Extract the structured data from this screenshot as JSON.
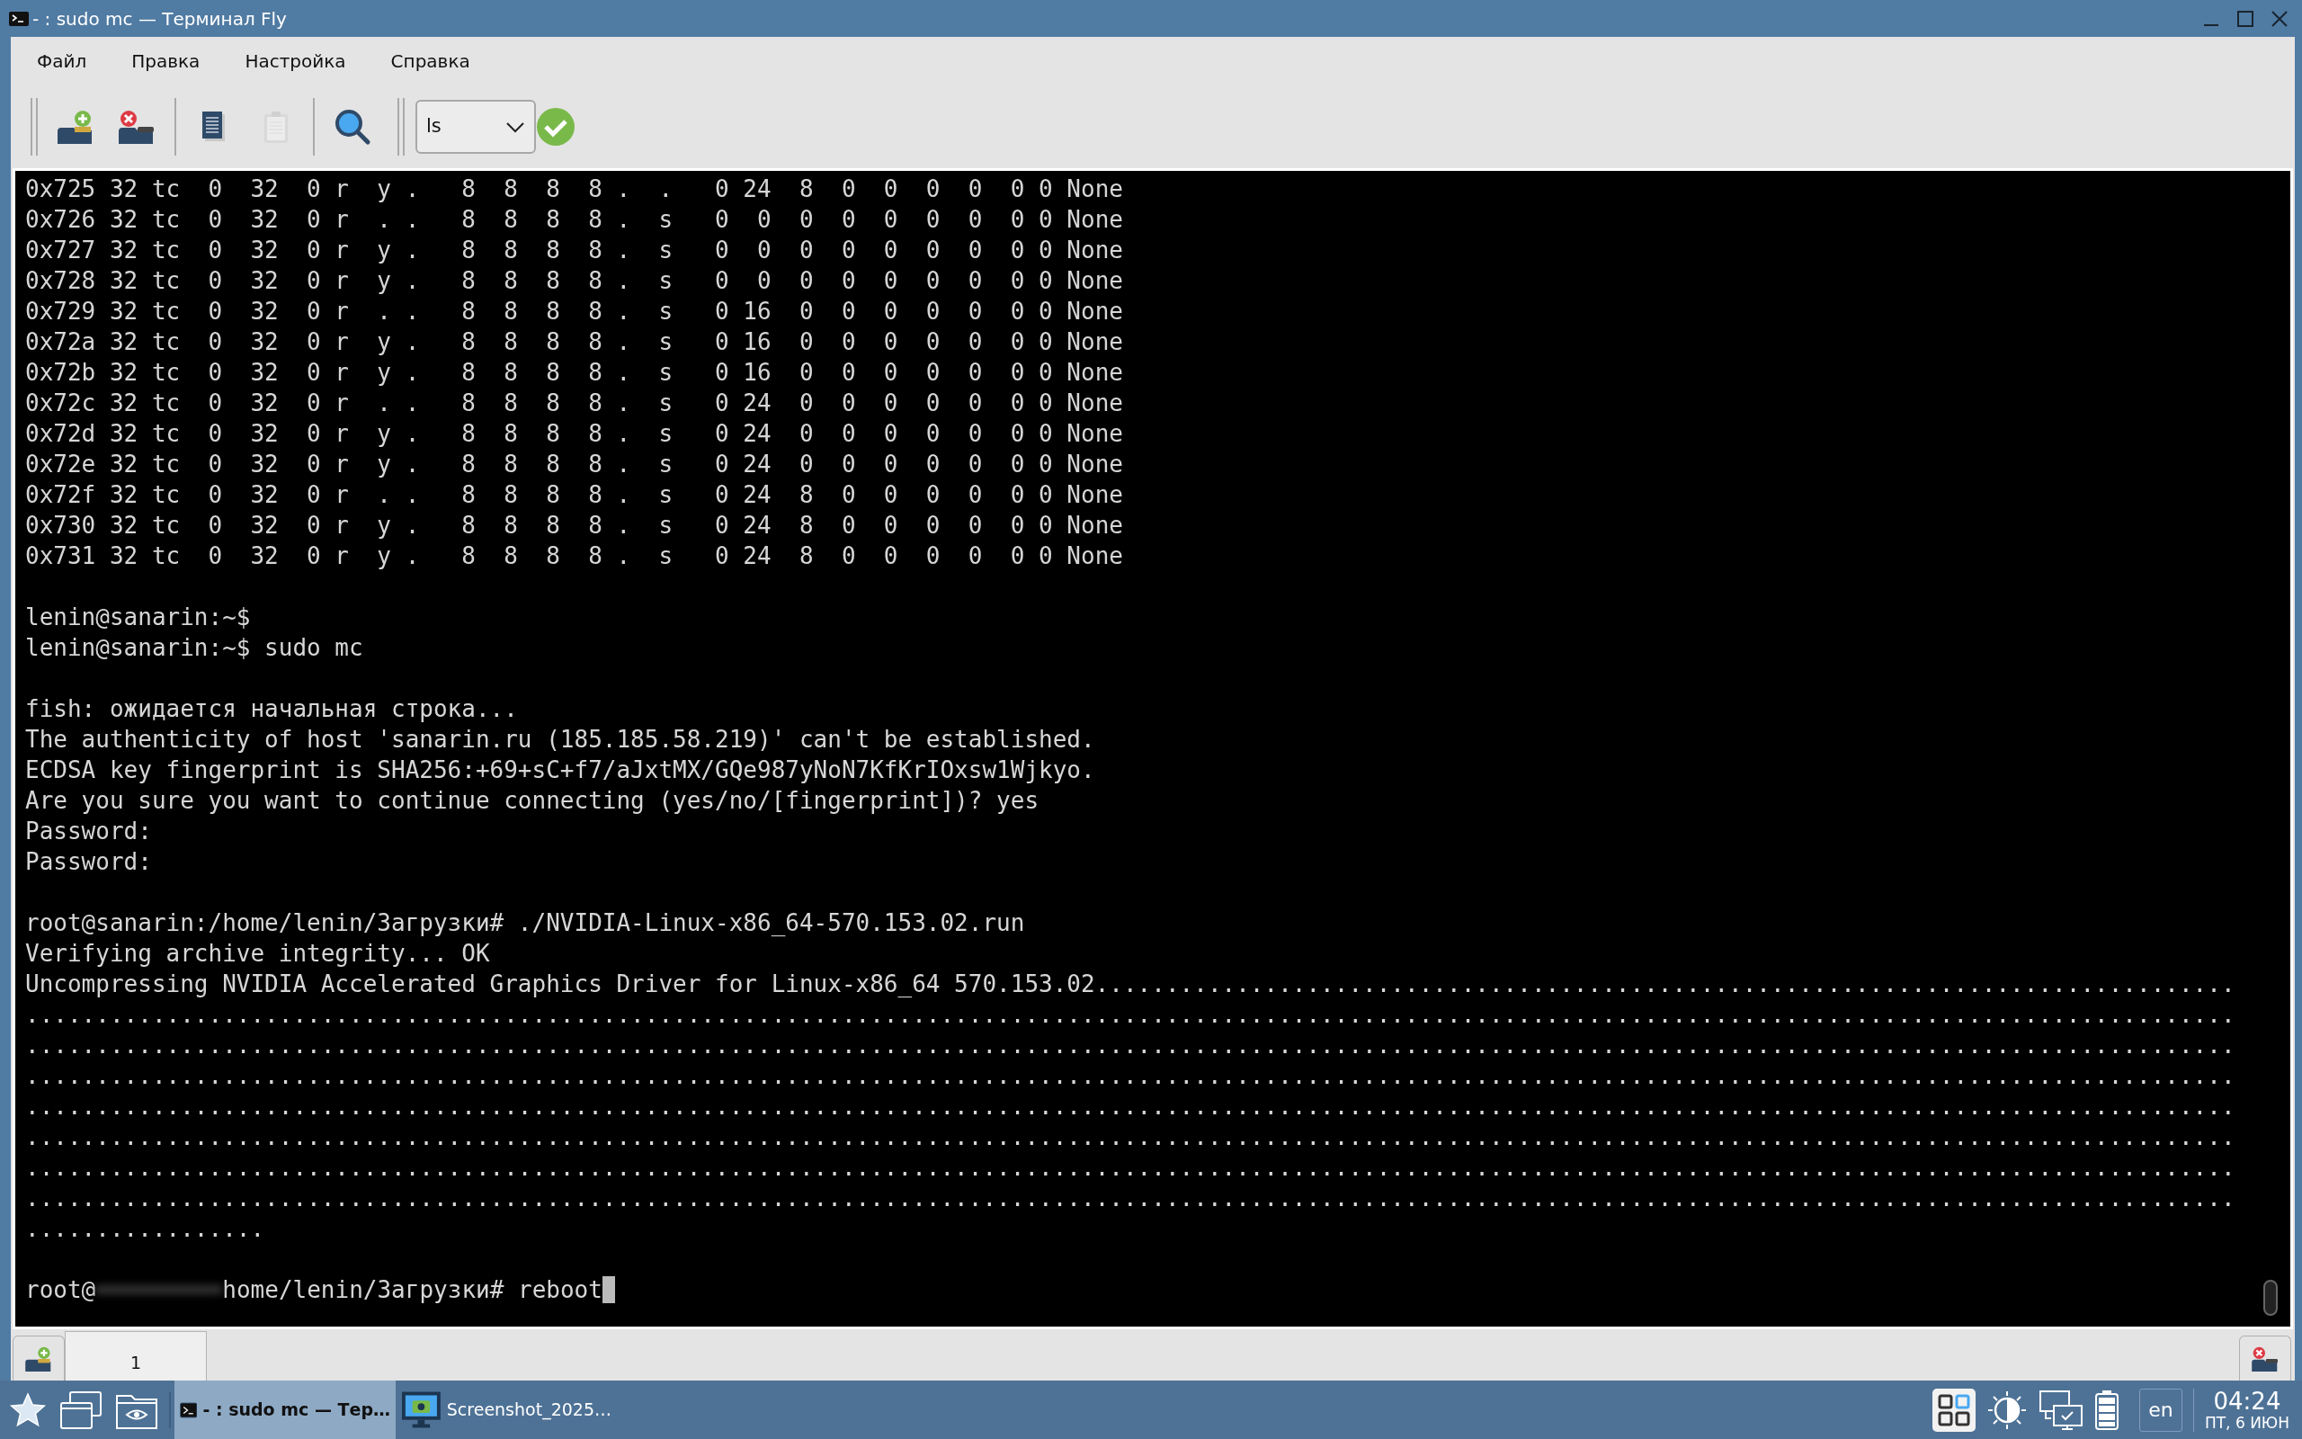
{
  "window": {
    "title": "- : sudo mc — Терминал Fly"
  },
  "menu": [
    "Файл",
    "Правка",
    "Настройка",
    "Справка"
  ],
  "toolbar": {
    "groups": [
      [
        {
          "kind": "new-tab",
          "disabled": false
        },
        {
          "kind": "close-tab",
          "disabled": false
        }
      ],
      [
        {
          "kind": "copy",
          "disabled": false
        },
        {
          "kind": "paste",
          "disabled": true
        }
      ],
      [
        {
          "kind": "search",
          "disabled": false
        }
      ]
    ],
    "command": {
      "value": "ls"
    }
  },
  "terminal": {
    "lines": [
      {
        "kind": "text",
        "text": "0x725 32 tc  0  32  0 r  y .   8  8  8  8 .  .   0 24  8  0  0  0  0  0 0 None"
      },
      {
        "kind": "text",
        "text": "0x726 32 tc  0  32  0 r  . .   8  8  8  8 .  s   0  0  0  0  0  0  0  0 0 None"
      },
      {
        "kind": "text",
        "text": "0x727 32 tc  0  32  0 r  y .   8  8  8  8 .  s   0  0  0  0  0  0  0  0 0 None"
      },
      {
        "kind": "text",
        "text": "0x728 32 tc  0  32  0 r  y .   8  8  8  8 .  s   0  0  0  0  0  0  0  0 0 None"
      },
      {
        "kind": "text",
        "text": "0x729 32 tc  0  32  0 r  . .   8  8  8  8 .  s   0 16  0  0  0  0  0  0 0 None"
      },
      {
        "kind": "text",
        "text": "0x72a 32 tc  0  32  0 r  y .   8  8  8  8 .  s   0 16  0  0  0  0  0  0 0 None"
      },
      {
        "kind": "text",
        "text": "0x72b 32 tc  0  32  0 r  y .   8  8  8  8 .  s   0 16  0  0  0  0  0  0 0 None"
      },
      {
        "kind": "text",
        "text": "0x72c 32 tc  0  32  0 r  . .   8  8  8  8 .  s   0 24  0  0  0  0  0  0 0 None"
      },
      {
        "kind": "text",
        "text": "0x72d 32 tc  0  32  0 r  y .   8  8  8  8 .  s   0 24  0  0  0  0  0  0 0 None"
      },
      {
        "kind": "text",
        "text": "0x72e 32 tc  0  32  0 r  y .   8  8  8  8 .  s   0 24  0  0  0  0  0  0 0 None"
      },
      {
        "kind": "text",
        "text": "0x72f 32 tc  0  32  0 r  . .   8  8  8  8 .  s   0 24  8  0  0  0  0  0 0 None"
      },
      {
        "kind": "text",
        "text": "0x730 32 tc  0  32  0 r  y .   8  8  8  8 .  s   0 24  8  0  0  0  0  0 0 None"
      },
      {
        "kind": "text",
        "text": "0x731 32 tc  0  32  0 r  y .   8  8  8  8 .  s   0 24  8  0  0  0  0  0 0 None"
      },
      {
        "kind": "blank"
      },
      {
        "kind": "text",
        "text": "lenin@sanarin:~$"
      },
      {
        "kind": "text",
        "text": "lenin@sanarin:~$ sudo mc"
      },
      {
        "kind": "blank"
      },
      {
        "kind": "text",
        "text": "fish: ожидается начальная строка..."
      },
      {
        "kind": "text",
        "text": "The authenticity of host 'sanarin.ru (185.185.58.219)' can't be established."
      },
      {
        "kind": "text",
        "text": "ECDSA key fingerprint is SHA256:+69+sC+f7/aJxtMX/GQe987yNoN7KfKrIOxsw1Wjkyo."
      },
      {
        "kind": "text",
        "text": "Are you sure you want to continue connecting (yes/no/[fingerprint])? yes"
      },
      {
        "kind": "text",
        "text": "Password:"
      },
      {
        "kind": "text",
        "text": "Password:"
      },
      {
        "kind": "blank"
      },
      {
        "kind": "text",
        "text": "root@sanarin:/home/lenin/Загрузки# ./NVIDIA-Linux-x86_64-570.153.02.run"
      },
      {
        "kind": "text",
        "text": "Verifying archive integrity... OK"
      },
      {
        "kind": "text",
        "text": "Uncompressing NVIDIA Accelerated Graphics Driver for Linux-x86_64 570.153.02................................................................................."
      },
      {
        "kind": "text",
        "text": "............................................................................................................................................................."
      },
      {
        "kind": "text",
        "text": "............................................................................................................................................................."
      },
      {
        "kind": "text",
        "text": "............................................................................................................................................................."
      },
      {
        "kind": "text",
        "text": "............................................................................................................................................................."
      },
      {
        "kind": "text",
        "text": "............................................................................................................................................................."
      },
      {
        "kind": "text",
        "text": "............................................................................................................................................................."
      },
      {
        "kind": "text",
        "text": "............................................................................................................................................................."
      },
      {
        "kind": "text",
        "text": "................."
      },
      {
        "kind": "blank"
      },
      {
        "kind": "redacted",
        "before": "root@",
        "after": "home/lenin/Загрузки# reboot",
        "cursor": true
      }
    ]
  },
  "tabs": [
    {
      "label": "1",
      "selected": true
    }
  ],
  "taskbar": {
    "tasks": [
      {
        "kind": "terminal",
        "label": "- : sudo mc — Тер…",
        "selected": true
      },
      {
        "kind": "viewer",
        "label": "Screenshot_2025…",
        "selected": false
      }
    ],
    "language": "en",
    "time": "04:24",
    "date": "ПТ, 6 ИЮН"
  }
}
